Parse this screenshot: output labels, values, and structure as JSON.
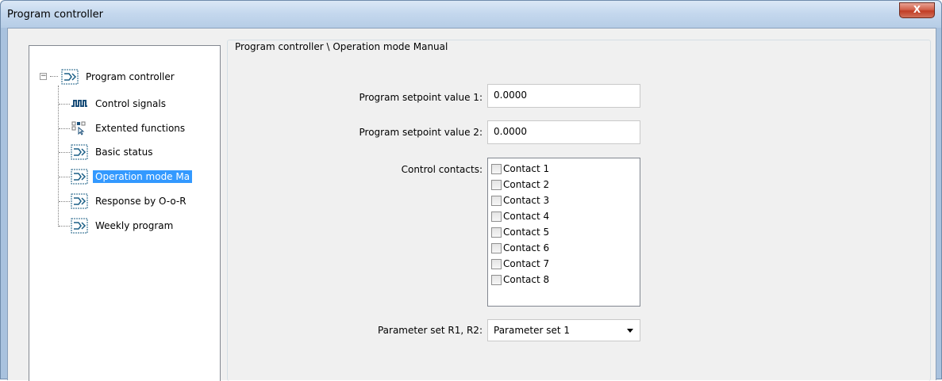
{
  "window": {
    "title": "Program controller",
    "close_glyph": "X"
  },
  "tree": {
    "items": [
      {
        "label": "Program controller",
        "icon": "program-controller-icon"
      },
      {
        "label": "Control signals",
        "icon": "signal-pulse-icon"
      },
      {
        "label": "Extented functions",
        "icon": "extended-functions-icon"
      },
      {
        "label": "Basic status",
        "icon": "program-controller-icon"
      },
      {
        "label": "Operation mode Ma",
        "icon": "program-controller-icon",
        "selected": true
      },
      {
        "label": "Response by O-o-R",
        "icon": "program-controller-icon"
      },
      {
        "label": "Weekly program",
        "icon": "program-controller-icon"
      }
    ]
  },
  "panel": {
    "group_title": "Program controller \\ Operation mode Manual",
    "setpoint1_label": "Program setpoint value 1:",
    "setpoint1_value": "0.0000",
    "setpoint2_label": "Program setpoint value 2:",
    "setpoint2_value": "0.0000",
    "contacts_label": "Control contacts:",
    "contacts": [
      "Contact 1",
      "Contact 2",
      "Contact 3",
      "Contact 4",
      "Contact 5",
      "Contact 6",
      "Contact 7",
      "Contact 8"
    ],
    "paramset_label": "Parameter set R1, R2:",
    "paramset_value": "Parameter set 1"
  }
}
